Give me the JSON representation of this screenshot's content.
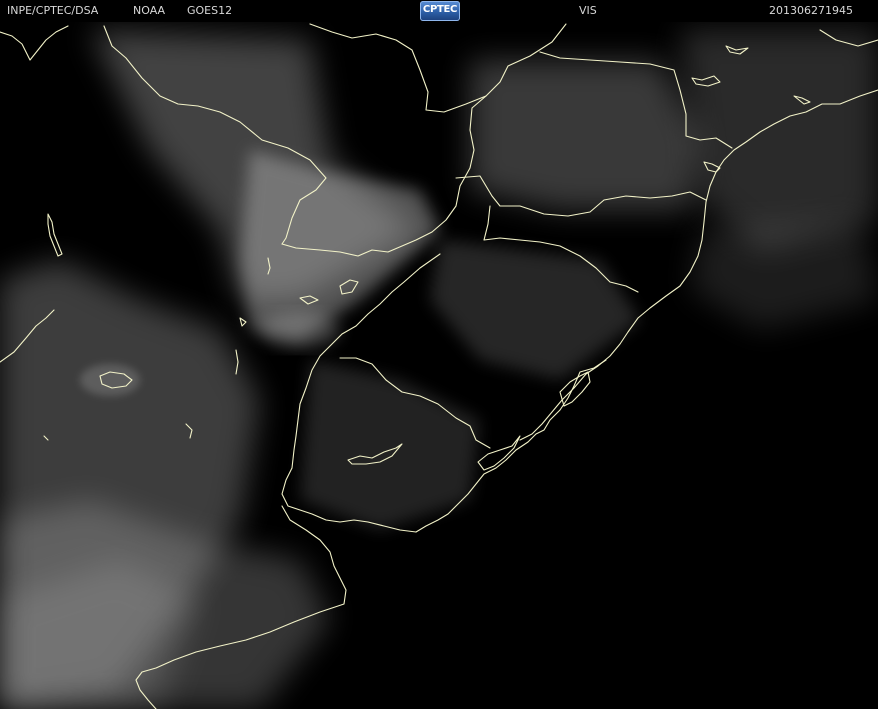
{
  "header": {
    "organization": "INPE/CPTEC/DSA",
    "agency": "NOAA",
    "satellite": "GOES12",
    "channel": "VIS",
    "timestamp": "201306271945"
  },
  "logo": {
    "text": "CPTEC"
  },
  "map": {
    "image_type": "visible satellite image",
    "border_color": "#f2f2c8",
    "background_color": "#000000",
    "cloud_color": "#bdbdbd"
  }
}
